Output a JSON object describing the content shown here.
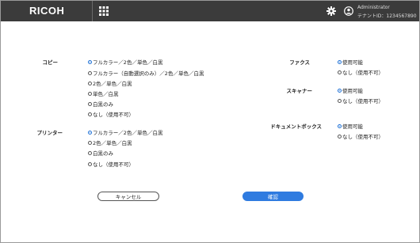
{
  "header": {
    "brand": "RICOH",
    "user_name": "Administrator",
    "tenant_id": "テナントID：1234567890"
  },
  "colors": {
    "topbar": "#3b3b3b",
    "accent": "#2f7be0"
  },
  "icons": [
    "app-grid-icon",
    "gear-icon",
    "user-circle-icon"
  ],
  "left_sections": [
    {
      "label": "コピー",
      "options": [
        {
          "label": "フルカラー／2色／単色／白黒",
          "selected": true
        },
        {
          "label": "フルカラー（自動選択のみ）／2色／単色／白黒",
          "selected": false
        },
        {
          "label": "2色／単色／白黒",
          "selected": false
        },
        {
          "label": "単色／白黒",
          "selected": false
        },
        {
          "label": "白黒のみ",
          "selected": false
        },
        {
          "label": "なし（使用不可）",
          "selected": false
        }
      ]
    },
    {
      "label": "プリンター",
      "options": [
        {
          "label": "フルカラー／2色／単色／白黒",
          "selected": true
        },
        {
          "label": "2色／単色／白黒",
          "selected": false
        },
        {
          "label": "白黒のみ",
          "selected": false
        },
        {
          "label": "なし（使用不可）",
          "selected": false
        }
      ]
    }
  ],
  "right_sections": [
    {
      "label": "ファクス",
      "options": [
        {
          "label": "使用可能",
          "selected": true
        },
        {
          "label": "なし（使用不可）",
          "selected": false
        }
      ]
    },
    {
      "label": "スキャナー",
      "options": [
        {
          "label": "使用可能",
          "selected": true
        },
        {
          "label": "なし（使用不可）",
          "selected": false
        }
      ]
    },
    {
      "label": "ドキュメントボックス",
      "options": [
        {
          "label": "使用可能",
          "selected": true
        },
        {
          "label": "なし（使用不可）",
          "selected": false
        }
      ]
    }
  ],
  "buttons": {
    "cancel": "キャンセル",
    "confirm": "確認"
  }
}
